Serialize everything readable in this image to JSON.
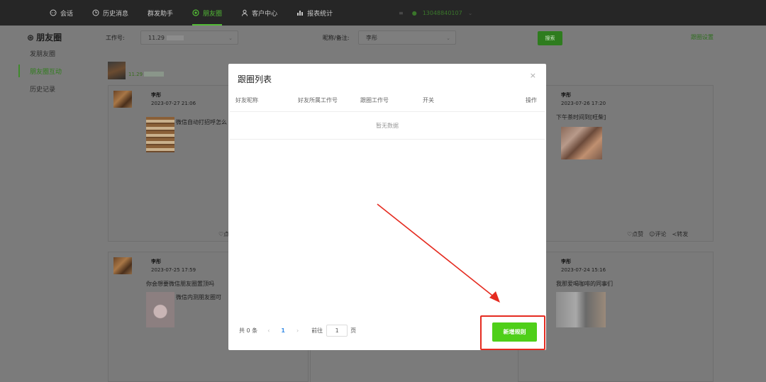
{
  "nav": {
    "items": [
      {
        "label": "会话",
        "icon": "chat-bubble-icon"
      },
      {
        "label": "历史消息",
        "icon": "clock-icon"
      },
      {
        "label": "群发助手",
        "icon": "none"
      },
      {
        "label": "朋友圈",
        "icon": "moments-icon"
      },
      {
        "label": "客户中心",
        "icon": "user-icon"
      },
      {
        "label": "报表统计",
        "icon": "bar-chart-icon"
      }
    ],
    "active_index": 3,
    "account": "13048840107"
  },
  "sidebar": {
    "title": "朋友圈",
    "items": [
      "发朋友圈",
      "朋友圈互动",
      "历史记录"
    ],
    "active_index": 1
  },
  "filters": {
    "work_label": "工作号:",
    "work_value": "11.29",
    "nick_label": "昵称/备注:",
    "nick_value": "李彤",
    "search_label": "搜索",
    "follow_settings": "跟圈设置"
  },
  "profile": {
    "name": "11.29"
  },
  "posts": [
    {
      "name": "李彤",
      "date": "2023-07-27 21:06",
      "text": "微信自动打招呼怎么",
      "action": "♡点"
    },
    {
      "name": "李彤",
      "date": "2023-07-26 17:20",
      "text": "下午茶时间到[旺柴]",
      "like": "♡点赞",
      "comment": "☺评论",
      "share": "≺转发"
    },
    {
      "name": "李彤",
      "date": "2023-07-25 17:59",
      "text": "你会想要微信朋友圈置顶吗",
      "text2": "微信内测朋友圈可"
    },
    {
      "name": "李彤",
      "date": "2023-07-24 15:16",
      "text": "我那爱喝咖啡的同事们"
    }
  ],
  "modal": {
    "title": "跟圈列表",
    "close": "×",
    "columns": [
      "好友昵称",
      "好友所属工作号",
      "跟圈工作号",
      "开关",
      "操作"
    ],
    "empty": "暂无数据",
    "total": "共 0 条",
    "prev": "‹",
    "current_page": "1",
    "next": "›",
    "goto_label": "前往",
    "goto_value": "1",
    "page_suffix": "页",
    "add_button": "新增规则"
  },
  "colors": {
    "accent": "#52b935",
    "add_button": "#4fcf19",
    "highlight": "#e52b20"
  }
}
